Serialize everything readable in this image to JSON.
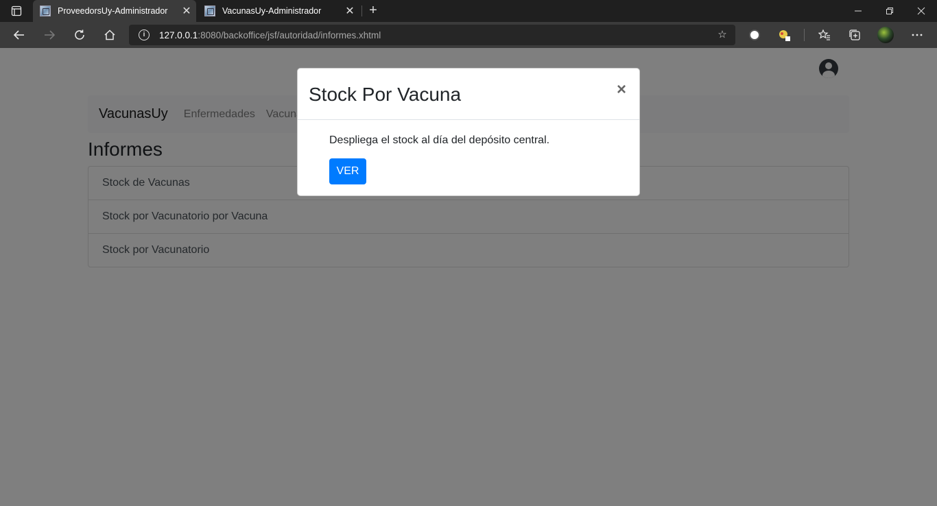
{
  "browser": {
    "tabs": [
      {
        "title": "ProveedorsUy-Administrador",
        "active": true
      },
      {
        "title": "VacunasUy-Administrador",
        "active": false
      }
    ],
    "close_glyph": "✕",
    "new_tab_glyph": "+",
    "url_host": "127.0.0.1",
    "url_rest": ":8080/backoffice/jsf/autoridad/informes.xhtml"
  },
  "page": {
    "brand": "VacunasUy",
    "nav_links": [
      "Enfermedades",
      "Vacunas"
    ],
    "heading": "Informes",
    "reports": [
      "Stock de Vacunas",
      "Stock por Vacunatorio por Vacuna",
      "Stock por Vacunatorio"
    ]
  },
  "modal": {
    "title": "Stock Por Vacuna",
    "close_glyph": "×",
    "description": "Despliega el stock al día del depósito central.",
    "button_label": "VER"
  },
  "colors": {
    "primary": "#007bff",
    "chrome_dark": "#1f1f1f",
    "chrome_toolbar": "#3b3b3b"
  }
}
